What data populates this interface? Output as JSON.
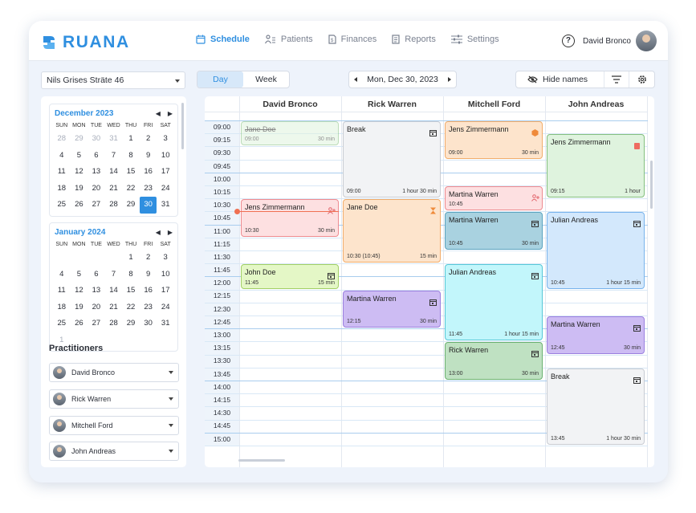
{
  "brand": {
    "name": "RUANA",
    "color": "#2f8fe0"
  },
  "nav": [
    {
      "label": "Schedule",
      "icon": "calendar-icon",
      "active": true
    },
    {
      "label": "Patients",
      "icon": "patients-icon",
      "active": false
    },
    {
      "label": "Finances",
      "icon": "finances-icon",
      "active": false
    },
    {
      "label": "Reports",
      "icon": "reports-icon",
      "active": false
    },
    {
      "label": "Settings",
      "icon": "sliders-icon",
      "active": false
    }
  ],
  "user": {
    "name": "David Bronco",
    "help": "?"
  },
  "location": {
    "selected": "Nils Grises Sträte 46"
  },
  "view": {
    "day_label": "Day",
    "week_label": "Week",
    "selected": "Day"
  },
  "date": {
    "label": "Mon, Dec 30, 2023"
  },
  "toolbar": {
    "hide_names_label": "Hide names"
  },
  "weekdays": [
    "SUN",
    "MON",
    "TUE",
    "WED",
    "THU",
    "FRI",
    "SAT"
  ],
  "calendars": [
    {
      "title": "December 2023",
      "days": [
        "28",
        "29",
        "30",
        "31",
        "1",
        "2",
        "3",
        "4",
        "5",
        "6",
        "7",
        "8",
        "9",
        "10",
        "11",
        "12",
        "13",
        "14",
        "15",
        "16",
        "17",
        "18",
        "19",
        "20",
        "21",
        "22",
        "23",
        "24",
        "25",
        "26",
        "27",
        "28",
        "29",
        "30",
        "31"
      ],
      "muted": [
        0,
        1,
        2,
        3
      ],
      "selected": 33
    },
    {
      "title": "January 2024",
      "days": [
        "",
        "",
        "",
        "",
        "1",
        "2",
        "3",
        "4",
        "5",
        "6",
        "7",
        "8",
        "9",
        "10",
        "11",
        "12",
        "13",
        "14",
        "15",
        "16",
        "17",
        "18",
        "19",
        "20",
        "21",
        "22",
        "23",
        "24",
        "25",
        "26",
        "27",
        "28",
        "29",
        "30",
        "31",
        "1"
      ],
      "muted": [
        35
      ],
      "selected": -1
    }
  ],
  "practitioners_title": "Practitioners",
  "practitioners": [
    "David Bronco",
    "Rick Warren",
    "Mitchell Ford",
    "John Andreas"
  ],
  "columns": [
    "David Bronco",
    "Rick Warren",
    "Mitchell Ford",
    "John Andreas"
  ],
  "times": [
    "09:00",
    "09:15",
    "09:30",
    "09:45",
    "10:00",
    "10:15",
    "10:30",
    "10:45",
    "11:00",
    "11:15",
    "11:30",
    "11:45",
    "12:00",
    "12:15",
    "12:30",
    "12:45",
    "13:00",
    "13:15",
    "13:30",
    "13:45",
    "14:00",
    "14:15",
    "14:30",
    "14:45",
    "15:00"
  ],
  "events": [
    {
      "col": 0,
      "start": 0,
      "slots": 2,
      "name": "Jane Doe",
      "time": "09:00",
      "dur": "30 min",
      "style": "g faded",
      "strike": true,
      "icon": ""
    },
    {
      "col": 0,
      "start": 6,
      "slots": 3,
      "name": "Jens Zimmermann",
      "time": "10:30",
      "dur": "30 min",
      "style": "rd",
      "icon": "user-add-icon"
    },
    {
      "col": 0,
      "start": 11,
      "slots": 2,
      "name": "John Doe",
      "time": "11:45",
      "dur": "15 min",
      "style": "lm",
      "icon": "calendar-icon"
    },
    {
      "col": 1,
      "start": 0,
      "slots": 6,
      "name": "Break",
      "time": "09:00",
      "dur": "1 hour 30 min",
      "style": "gy",
      "icon": "calendar-icon"
    },
    {
      "col": 1,
      "start": 6,
      "slots": 5,
      "name": "Jane Doe",
      "time": "10:30 (10:45)",
      "dur": "15 min",
      "style": "or",
      "icon": "hourglass-icon"
    },
    {
      "col": 1,
      "start": 13,
      "slots": 3,
      "name": "Martina Warren",
      "time": "12:15",
      "dur": "30 min",
      "style": "pu",
      "icon": "calendar-icon"
    },
    {
      "col": 2,
      "start": 0,
      "slots": 3,
      "name": "Jens Zimmermann",
      "time": "09:00",
      "dur": "30 min",
      "style": "or",
      "icon": "hex-icon"
    },
    {
      "col": 2,
      "start": 5,
      "slots": 2,
      "name": "Martina Warren",
      "time": "10:45",
      "dur": "",
      "style": "rd",
      "icon": "user-add-icon"
    },
    {
      "col": 2,
      "start": 7,
      "slots": 3,
      "name": "Martina Warren",
      "time": "10:45",
      "dur": "30 min",
      "style": "tl",
      "icon": "calendar-icon"
    },
    {
      "col": 2,
      "start": 11,
      "slots": 6,
      "name": "Julian Andreas",
      "time": "11:45",
      "dur": "1 hour 15 min",
      "style": "cy",
      "icon": "calendar-icon"
    },
    {
      "col": 2,
      "start": 17,
      "slots": 3,
      "name": "Rick Warren",
      "time": "13:00",
      "dur": "30 min",
      "style": "gd",
      "icon": "calendar-icon"
    },
    {
      "col": 3,
      "start": 1,
      "slots": 5,
      "name": "Jens Zimmermann",
      "time": "09:15",
      "dur": "1 hour",
      "style": "g",
      "icon": "clipboard-icon"
    },
    {
      "col": 3,
      "start": 7,
      "slots": 6,
      "name": "Julian Andreas",
      "time": "10:45",
      "dur": "1 hour 15 min",
      "style": "bl",
      "icon": "calendar-icon"
    },
    {
      "col": 3,
      "start": 15,
      "slots": 3,
      "name": "Martina Warren",
      "time": "12:45",
      "dur": "30 min",
      "style": "pu",
      "icon": "calendar-icon"
    },
    {
      "col": 3,
      "start": 19,
      "slots": 6,
      "name": "Break",
      "time": "13:45",
      "dur": "1 hour 30 min",
      "style": "gy",
      "icon": "calendar-icon"
    }
  ]
}
